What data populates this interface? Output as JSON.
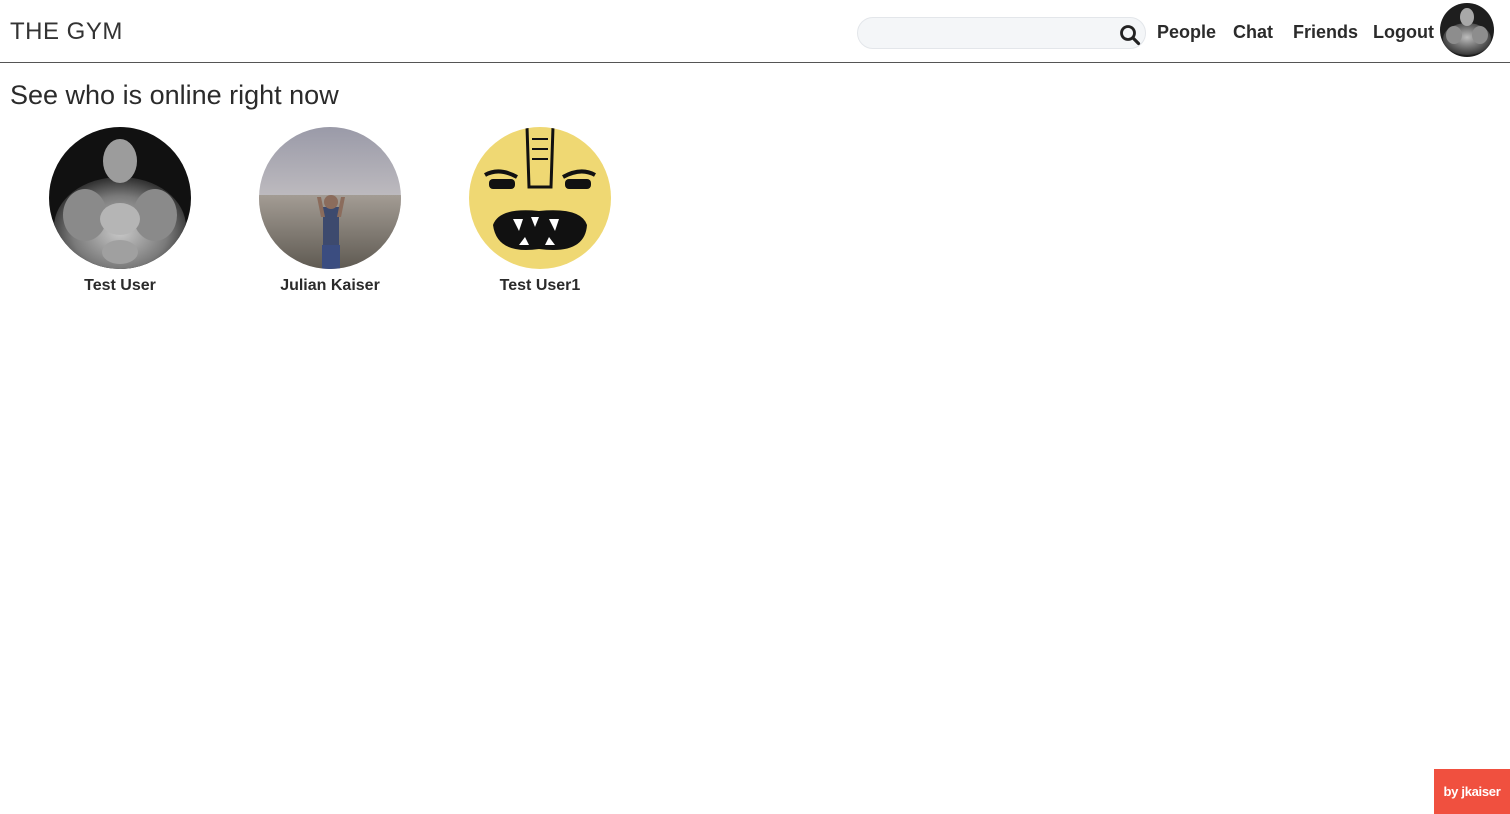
{
  "header": {
    "brand": "THE GYM",
    "search": {
      "value": "",
      "placeholder": ""
    },
    "nav": {
      "people": "People",
      "chat": "Chat",
      "friends": "Friends",
      "logout": "Logout"
    }
  },
  "main": {
    "title": "See who is online right now",
    "users": [
      {
        "name": "Test User"
      },
      {
        "name": "Julian Kaiser"
      },
      {
        "name": "Test User1"
      }
    ]
  },
  "footer": {
    "credit": "by jkaiser"
  },
  "colors": {
    "accent": "#f0503f",
    "avatar_yellow": "#efd873",
    "search_bg": "#f4f6f8"
  }
}
